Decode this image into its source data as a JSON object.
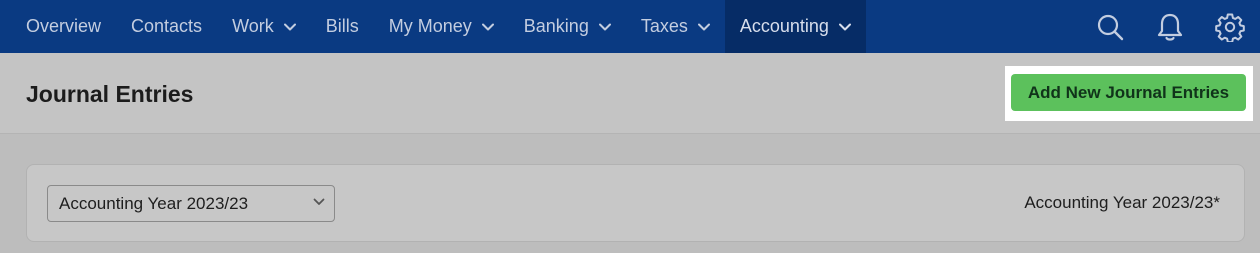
{
  "nav": {
    "items": [
      {
        "label": "Overview",
        "has_dropdown": false,
        "active": false
      },
      {
        "label": "Contacts",
        "has_dropdown": false,
        "active": false
      },
      {
        "label": "Work",
        "has_dropdown": true,
        "active": false
      },
      {
        "label": "Bills",
        "has_dropdown": false,
        "active": false
      },
      {
        "label": "My Money",
        "has_dropdown": true,
        "active": false
      },
      {
        "label": "Banking",
        "has_dropdown": true,
        "active": false
      },
      {
        "label": "Taxes",
        "has_dropdown": true,
        "active": false
      },
      {
        "label": "Accounting",
        "has_dropdown": true,
        "active": true
      }
    ],
    "icons": [
      "search-icon",
      "bell-icon",
      "gear-icon"
    ]
  },
  "header": {
    "title": "Journal Entries",
    "cta_label": "Add New Journal Entries"
  },
  "filter": {
    "select_value": "Accounting Year 2023/23",
    "year_label": "Accounting Year 2023/23*"
  },
  "colors": {
    "nav_bg": "#0a3a82",
    "nav_active_bg": "#062c66",
    "cta_bg": "#5cc15c",
    "highlight": "#ffffff"
  }
}
